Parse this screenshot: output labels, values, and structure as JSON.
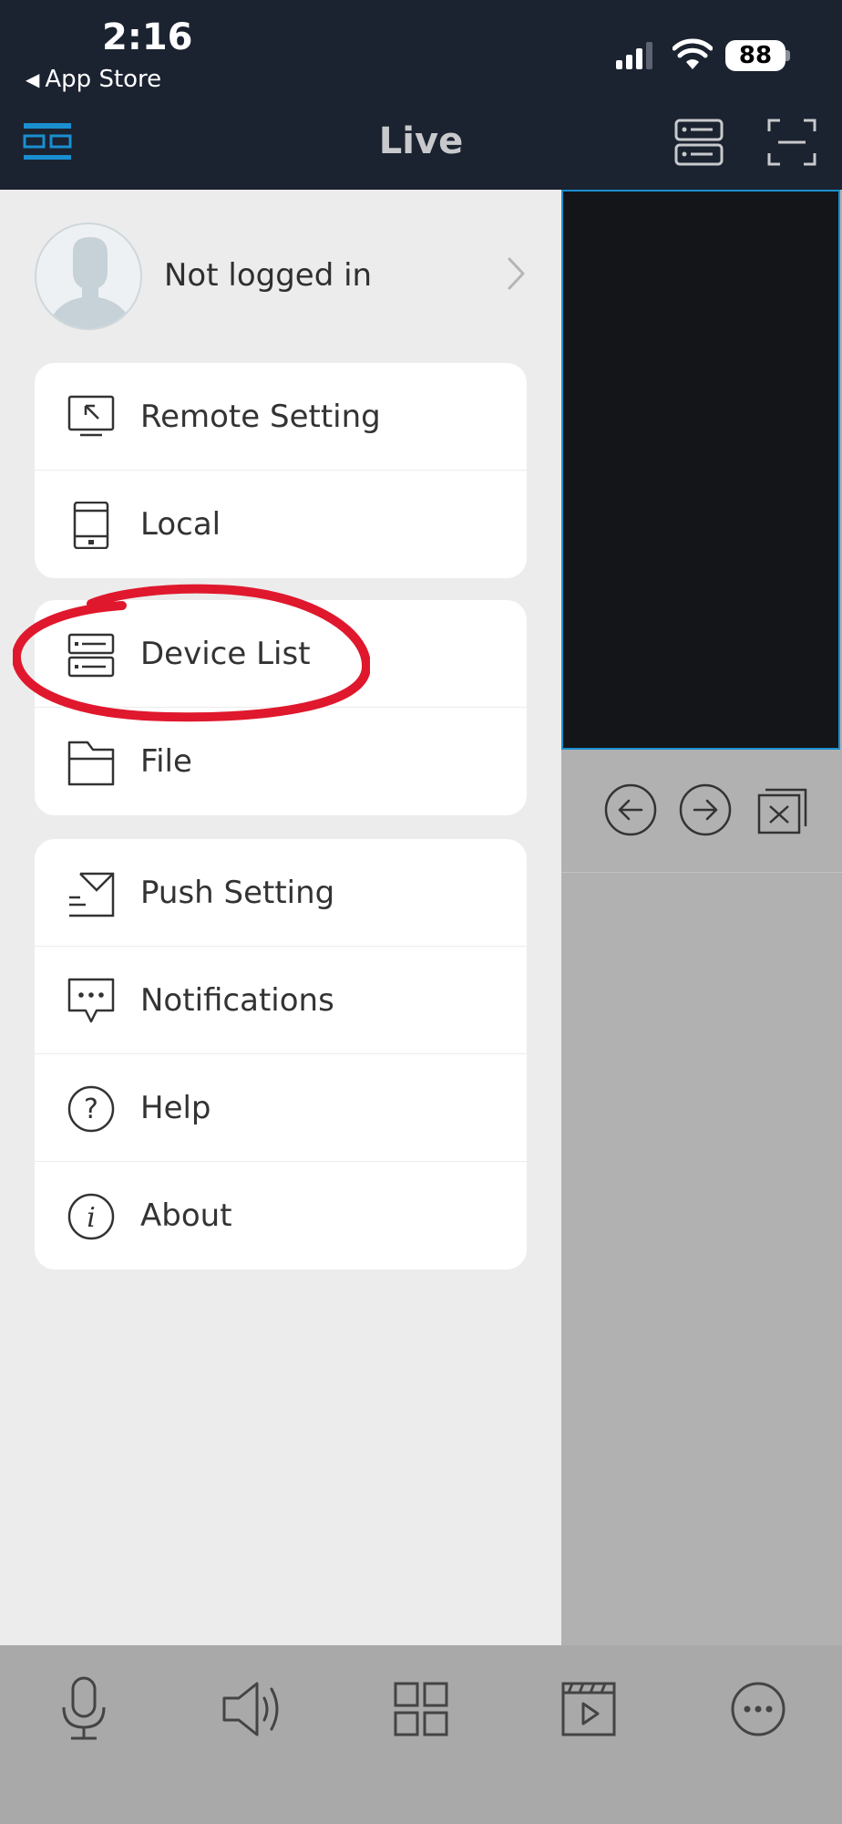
{
  "status": {
    "time": "2:16",
    "back_label": "App Store",
    "battery": "88"
  },
  "navbar": {
    "title": "Live"
  },
  "profile": {
    "label": "Not logged in"
  },
  "menu": {
    "group1": [
      {
        "label": "Remote Setting",
        "icon": "remote-setting-icon"
      },
      {
        "label": "Local",
        "icon": "phone-icon"
      }
    ],
    "group2": [
      {
        "label": "Device List",
        "icon": "device-list-icon"
      },
      {
        "label": "File",
        "icon": "folder-icon"
      }
    ],
    "group3": [
      {
        "label": "Push Setting",
        "icon": "push-mail-icon"
      },
      {
        "label": "Notifications",
        "icon": "chat-bubble-icon"
      },
      {
        "label": "Help",
        "icon": "question-icon"
      },
      {
        "label": "About",
        "icon": "info-icon"
      }
    ]
  },
  "colors": {
    "accent": "#1a8fd0",
    "header_bg": "#1b2230",
    "annotation": "#e0182d"
  }
}
